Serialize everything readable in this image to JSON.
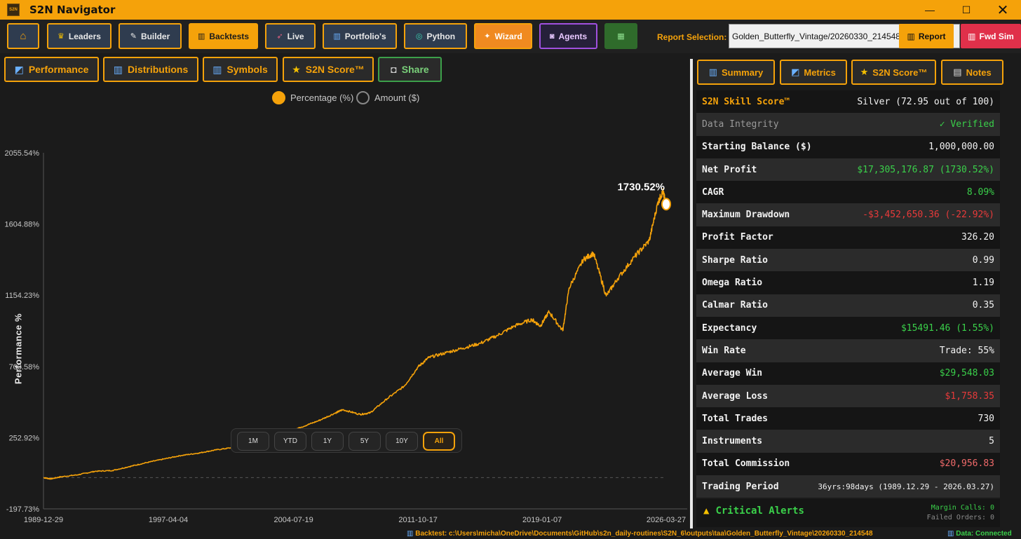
{
  "window": {
    "title": "S2N Navigator",
    "logo_text": "S2N"
  },
  "toolbar": {
    "home_icon": "home-icon",
    "buttons": [
      {
        "label": "Leaders",
        "icon": "trophy-icon"
      },
      {
        "label": "Builder",
        "icon": "wrench-icon"
      },
      {
        "label": "Backtests",
        "icon": "chart-icon"
      },
      {
        "label": "Live",
        "icon": "rocket-icon"
      },
      {
        "label": "Portfolio's",
        "icon": "chart-icon"
      },
      {
        "label": "Python",
        "icon": "python-icon"
      },
      {
        "label": "Wizard",
        "icon": "wand-icon"
      },
      {
        "label": "Agents",
        "icon": "robot-icon"
      }
    ],
    "report_selection_label": "Report Selection:",
    "report_selection_value": "Golden_Butterfly_Vintage/20260330_214548  |  ",
    "report_button": "Report",
    "fwd_sim_button": "Fwd Sim"
  },
  "left_tabs": [
    {
      "label": "Performance",
      "icon": "line-chart-icon"
    },
    {
      "label": "Distributions",
      "icon": "bar-chart-icon"
    },
    {
      "label": "Symbols",
      "icon": "bar-chart-icon"
    },
    {
      "label": "S2N Score™",
      "icon": "star-icon"
    },
    {
      "label": "Share",
      "icon": "camera-icon"
    }
  ],
  "chart_controls": {
    "percentage_label": "Percentage (%)",
    "amount_label": "Amount ($)",
    "selected": "Percentage (%)",
    "ranges": [
      "1M",
      "YTD",
      "1Y",
      "5Y",
      "10Y",
      "All"
    ],
    "active_range": "All"
  },
  "chart_data": {
    "type": "line",
    "ylabel": "Performance %",
    "xlabel": "",
    "ylim": [
      -197.73,
      2055.54
    ],
    "y_ticks": [
      "2055.54%",
      "1604.88%",
      "1154.23%",
      "703.58%",
      "252.92%",
      "-197.73%"
    ],
    "y_tick_values": [
      2055.54,
      1604.88,
      1154.23,
      703.58,
      252.92,
      -197.73
    ],
    "x_ticks": [
      "1989-12-29",
      "1997-04-04",
      "2004-07-19",
      "2011-10-17",
      "2019-01-07",
      "2026-03-27"
    ],
    "x_range": [
      "1989-12-29",
      "2026-03-27"
    ],
    "end_label": "1730.52%",
    "line_color": "#f5a20a",
    "series": [
      {
        "values": [
          [
            "1989-12-29",
            0
          ],
          [
            "1990-06-01",
            -8
          ],
          [
            "1991-01-01",
            5
          ],
          [
            "1992-01-01",
            18
          ],
          [
            "1993-01-01",
            40
          ],
          [
            "1994-01-01",
            45
          ],
          [
            "1995-01-01",
            70
          ],
          [
            "1996-01-01",
            95
          ],
          [
            "1997-01-01",
            118
          ],
          [
            "1998-01-01",
            140
          ],
          [
            "1999-01-01",
            155
          ],
          [
            "2000-01-01",
            175
          ],
          [
            "2001-01-01",
            190
          ],
          [
            "2002-01-01",
            210
          ],
          [
            "2003-01-01",
            240
          ],
          [
            "2004-01-01",
            280
          ],
          [
            "2005-01-01",
            320
          ],
          [
            "2006-01-01",
            360
          ],
          [
            "2007-01-01",
            410
          ],
          [
            "2007-06-01",
            430
          ],
          [
            "2008-06-01",
            400
          ],
          [
            "2009-01-01",
            410
          ],
          [
            "2010-01-01",
            500
          ],
          [
            "2011-01-01",
            580
          ],
          [
            "2011-10-17",
            700
          ],
          [
            "2012-06-01",
            760
          ],
          [
            "2013-06-01",
            790
          ],
          [
            "2014-06-01",
            820
          ],
          [
            "2015-06-01",
            850
          ],
          [
            "2016-06-01",
            900
          ],
          [
            "2017-06-01",
            960
          ],
          [
            "2018-06-01",
            1000
          ],
          [
            "2018-12-01",
            960
          ],
          [
            "2019-06-01",
            1050
          ],
          [
            "2020-03-20",
            930
          ],
          [
            "2020-08-01",
            1200
          ],
          [
            "2021-06-01",
            1380
          ],
          [
            "2022-01-01",
            1420
          ],
          [
            "2022-10-01",
            1150
          ],
          [
            "2023-06-01",
            1260
          ],
          [
            "2024-06-01",
            1400
          ],
          [
            "2025-04-01",
            1500
          ],
          [
            "2025-10-01",
            1740
          ],
          [
            "2026-01-15",
            1810
          ],
          [
            "2026-03-27",
            1730.52
          ]
        ]
      }
    ]
  },
  "right_tabs": [
    {
      "label": "Summary",
      "icon": "chart-icon"
    },
    {
      "label": "Metrics",
      "icon": "line-chart-icon"
    },
    {
      "label": "S2N Score™",
      "icon": "star-icon"
    },
    {
      "label": "Notes",
      "icon": "note-icon"
    }
  ],
  "metrics": [
    {
      "key": "S2N Skill Score™",
      "value": "Silver (72.95 out of 100)",
      "style": "head"
    },
    {
      "key": "Data Integrity",
      "value": "✓ Verified",
      "style": "dim",
      "value_color": "green"
    },
    {
      "key": "Starting Balance ($)",
      "value": "1,000,000.00"
    },
    {
      "key": "Net Profit",
      "value": "$17,305,176.87 (1730.52%)",
      "value_color": "green"
    },
    {
      "key": "CAGR",
      "value": "8.09%",
      "value_color": "green"
    },
    {
      "key": "Maximum Drawdown",
      "value": "-$3,452,650.36 (-22.92%)",
      "value_color": "red"
    },
    {
      "key": "Profit Factor",
      "value": "326.20"
    },
    {
      "key": "Sharpe Ratio",
      "value": "0.99"
    },
    {
      "key": "Omega Ratio",
      "value": "1.19"
    },
    {
      "key": "Calmar Ratio",
      "value": "0.35"
    },
    {
      "key": "Expectancy",
      "value": "$15491.46 (1.55%)",
      "value_color": "green"
    },
    {
      "key": "Win Rate",
      "value": "Trade: 55%"
    },
    {
      "key": "Average Win",
      "value": "$29,548.03",
      "value_color": "green"
    },
    {
      "key": "Average Loss",
      "value": "$1,758.35",
      "value_color": "red"
    },
    {
      "key": "Total Trades",
      "value": "730"
    },
    {
      "key": "Instruments",
      "value": "5"
    },
    {
      "key": "Total Commission",
      "value": "$20,956.83",
      "value_color": "pink"
    },
    {
      "key": "Trading Period",
      "value": "36yrs:98days (1989.12.29 - 2026.03.27)",
      "value_size": "small"
    }
  ],
  "alerts": {
    "title": "Critical Alerts",
    "margin_calls": "Margin Calls: 0",
    "failed_orders": "Failed Orders: 0"
  },
  "status": {
    "backtest_path": "Backtest: c:\\Users\\micha\\OneDrive\\Documents\\GitHub\\s2n_daily-routines\\S2N_6\\outputs\\taa\\Golden_Butterfly_Vintage\\20260330_214548",
    "connection": "Data: Connected"
  }
}
